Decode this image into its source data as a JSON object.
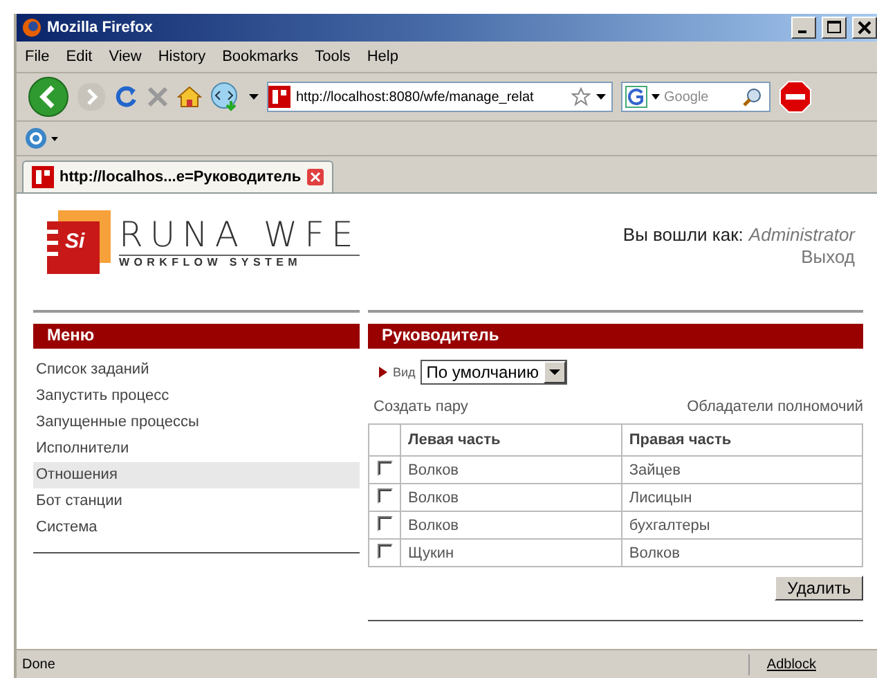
{
  "window": {
    "title": "Mozilla Firefox"
  },
  "menu_bar": [
    "File",
    "Edit",
    "View",
    "History",
    "Bookmarks",
    "Tools",
    "Help"
  ],
  "address_bar": {
    "url": "http://localhost:8080/wfe/manage_relat"
  },
  "search": {
    "placeholder": "Google"
  },
  "tabs": [
    {
      "title": "http://localhos...e=Руководитель",
      "selected": true
    }
  ],
  "page": {
    "logo": {
      "mark": "Si",
      "name": "RUNA WFE",
      "tagline": "WORKFLOW SYSTEM"
    },
    "login": {
      "label": "Вы вошли как:",
      "user": "Administrator",
      "logout": "Выход"
    },
    "menu": {
      "title": "Меню",
      "items": [
        {
          "label": "Список заданий",
          "selected": false
        },
        {
          "label": "Запустить процесс",
          "selected": false
        },
        {
          "label": "Запущенные процессы",
          "selected": false
        },
        {
          "label": "Исполнители",
          "selected": false
        },
        {
          "label": "Отношения",
          "selected": true
        },
        {
          "label": "Бот станции",
          "selected": false
        },
        {
          "label": "Система",
          "selected": false
        }
      ]
    },
    "panel": {
      "title": "Руководитель",
      "view_label": "Вид",
      "view_value": "По умолчанию",
      "create_link": "Создать пару",
      "owners_link": "Обладатели полномочий",
      "table": {
        "columns": [
          "Левая часть",
          "Правая часть"
        ],
        "rows": [
          {
            "left": "Волков",
            "right": "Зайцев",
            "checked": false
          },
          {
            "left": "Волков",
            "right": "Лисицын",
            "checked": false
          },
          {
            "left": "Волков",
            "right": "бухгалтеры",
            "checked": false
          },
          {
            "left": "Щукин",
            "right": "Волков",
            "checked": false
          }
        ]
      },
      "delete_button": "Удалить"
    }
  },
  "status_bar": {
    "text": "Done",
    "panel": "Adblock"
  }
}
